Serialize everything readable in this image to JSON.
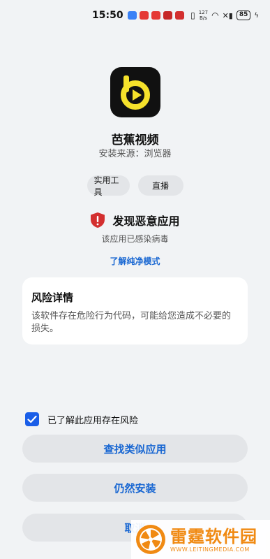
{
  "status_bar": {
    "time": "15:50",
    "net_speed_value": "127",
    "net_speed_unit": "B/s",
    "battery": "85"
  },
  "app": {
    "name": "芭蕉视频",
    "source": "安装来源：浏览器",
    "icon": "play-logo-icon",
    "icon_color": "#f5e12b"
  },
  "tags": [
    "实用工具",
    "直播"
  ],
  "warning": {
    "title": "发现恶意应用",
    "subtitle": "该应用已感染病毒",
    "link": "了解纯净模式",
    "icon_color": "#d32f2f"
  },
  "risk": {
    "title": "风险详情",
    "description": "该软件存在危险行为代码，可能给您造成不必要的损失。"
  },
  "acknowledge": {
    "label": "已了解此应用存在风险",
    "checked": true
  },
  "buttons": {
    "find_similar": "查找类似应用",
    "install_anyway": "仍然安装",
    "cancel": "取消"
  },
  "watermark": {
    "title": "雷霆软件园",
    "url": "WWW.LEITINGMEDIA.COM"
  },
  "colors": {
    "accent": "#1967d2",
    "checkbox": "#1a5ee8",
    "watermark": "#f08a13"
  }
}
